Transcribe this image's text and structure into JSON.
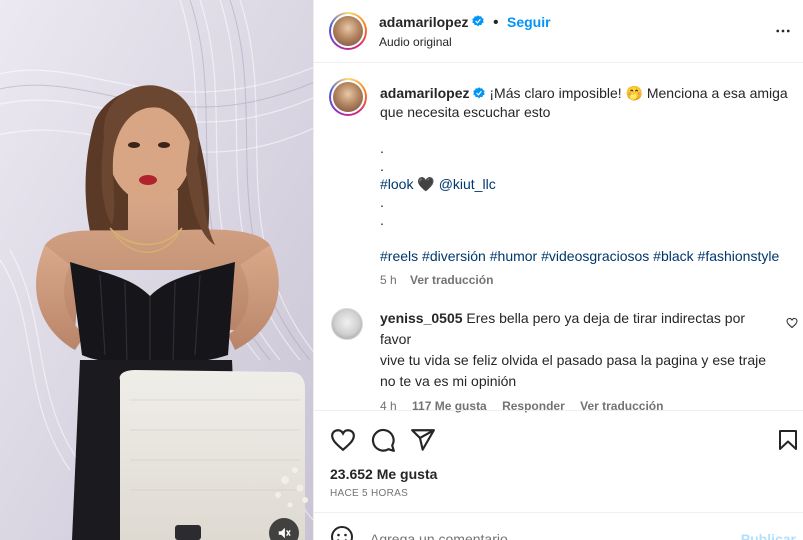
{
  "post": {
    "username": "adamarilopez",
    "follow_label": "Seguir",
    "audio": "Audio original"
  },
  "caption": {
    "username": "adamarilopez",
    "text_line1": "¡Más claro imposible! 🤭  Menciona a esa amiga",
    "text_line2": "que necesita escuchar esto",
    "dot1": ".",
    "dot2": ".",
    "mention_line_tag": "#look",
    "mention_line_heart": "🖤",
    "mention_line_user": "@kiut_llc",
    "dot3": ".",
    "dot4": ".",
    "hashtags": [
      "#reels",
      "#diversión",
      "#humor",
      "#videosgraciosos",
      "#black",
      "#fashionstyle"
    ],
    "time": "5 h",
    "translate_label": "Ver traducción"
  },
  "comment": {
    "username": "yeniss_0505",
    "line1": "Eres bella pero ya deja de tirar indirectas por favor",
    "line2": "vive tu vida se feliz olvida el pasado pasa la pagina y ese traje",
    "line3": "no te va es mi opinión",
    "time": "4 h",
    "likes": "117 Me gusta",
    "reply_label": "Responder",
    "translate_label": "Ver traducción"
  },
  "stats": {
    "likes": "23.652 Me gusta",
    "when": "HACE 5 HORAS"
  },
  "composer": {
    "placeholder": "Agrega un comentario...",
    "publish_label": "Publicar"
  },
  "colors": {
    "accent": "#0095f6",
    "link": "#00376b",
    "muted": "#737373",
    "publish_disabled": "#b2dffc"
  },
  "icons": [
    "verified-badge-icon",
    "more-options-icon",
    "heart-icon",
    "comment-icon",
    "share-icon",
    "bookmark-icon",
    "emoji-icon",
    "mute-icon",
    "heart-small-icon"
  ]
}
